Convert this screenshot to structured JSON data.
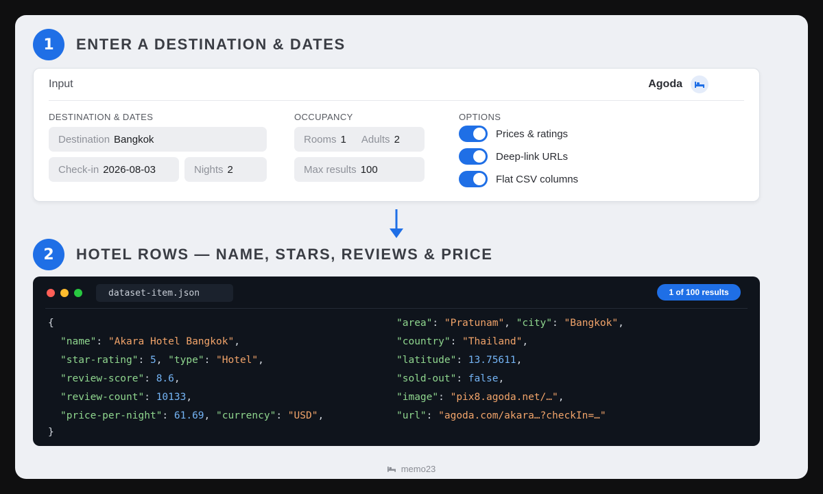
{
  "step1": {
    "number": "1",
    "title": "ENTER A DESTINATION & DATES"
  },
  "step2": {
    "number": "2",
    "title": "HOTEL ROWS — NAME, STARS, REVIEWS & PRICE"
  },
  "input_card": {
    "title": "Input",
    "brand": "Agoda",
    "brand_icon": "bed-icon",
    "destination_section": {
      "label": "DESTINATION & DATES",
      "destination": {
        "label": "Destination",
        "value": "Bangkok"
      },
      "checkin": {
        "label": "Check-in",
        "value": "2026-08-03"
      },
      "nights": {
        "label": "Nights",
        "value": "2"
      }
    },
    "occupancy_section": {
      "label": "OCCUPANCY",
      "rooms": {
        "label": "Rooms",
        "value": "1"
      },
      "adults": {
        "label": "Adults",
        "value": "2"
      },
      "max_results": {
        "label": "Max results",
        "value": "100"
      }
    },
    "options_section": {
      "label": "OPTIONS",
      "toggles": [
        {
          "label": "Prices & ratings",
          "on": true
        },
        {
          "label": "Deep-link URLs",
          "on": true
        },
        {
          "label": "Flat CSV columns",
          "on": true
        }
      ]
    }
  },
  "code_panel": {
    "filename": "dataset-item.json",
    "badge": "1 of 100 results",
    "item": {
      "name": "Akara Hotel Bangkok",
      "star-rating": "5",
      "type": "Hotel",
      "review-score": "8.6",
      "review-count": "10133",
      "price-per-night": "61.69",
      "currency": "USD",
      "area": "Pratunam",
      "city": "Bangkok",
      "country": "Thailand",
      "latitude": "13.75611",
      "sold-out": "false",
      "image": "pix8.agoda.net/…",
      "url": "agoda.com/akara…?checkIn=…"
    }
  },
  "footer": {
    "text": "memo23",
    "icon": "bed-icon"
  },
  "colors": {
    "accent": "#1f6fe6",
    "code_bg": "#0f141c",
    "key": "#8fd68e",
    "string": "#f2a46a",
    "number": "#74b4f5"
  }
}
